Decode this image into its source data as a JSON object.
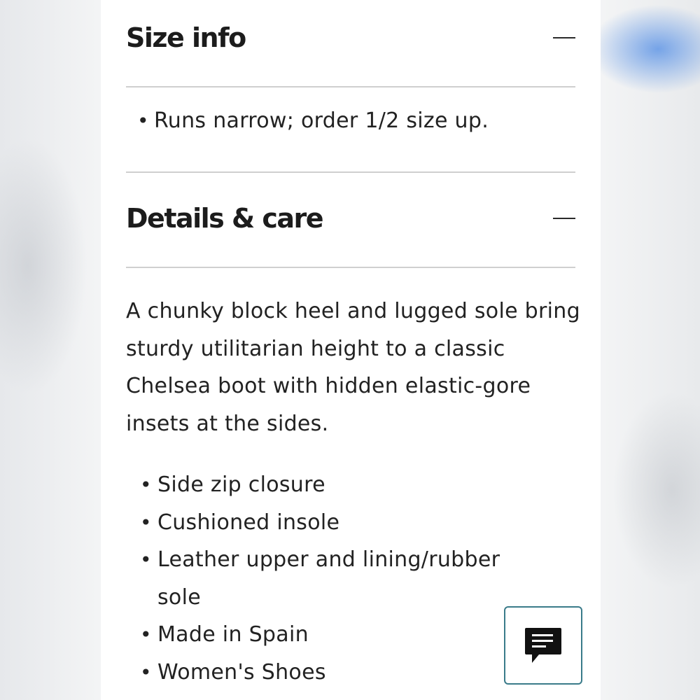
{
  "size_info": {
    "title": "Size info",
    "items": [
      "Runs narrow; order 1/2 size up."
    ]
  },
  "details_care": {
    "title": "Details & care",
    "description": "A chunky block heel and lugged sole bring sturdy utilitarian height to a classic Chelsea boot with hidden elastic-gore insets at the sides.",
    "features": [
      "Side zip closure",
      "Cushioned insole",
      "Leather upper and lining/rubber sole",
      "Made in Spain",
      "Women's Shoes"
    ]
  },
  "chat": {
    "icon": "chat-bubble-icon"
  }
}
